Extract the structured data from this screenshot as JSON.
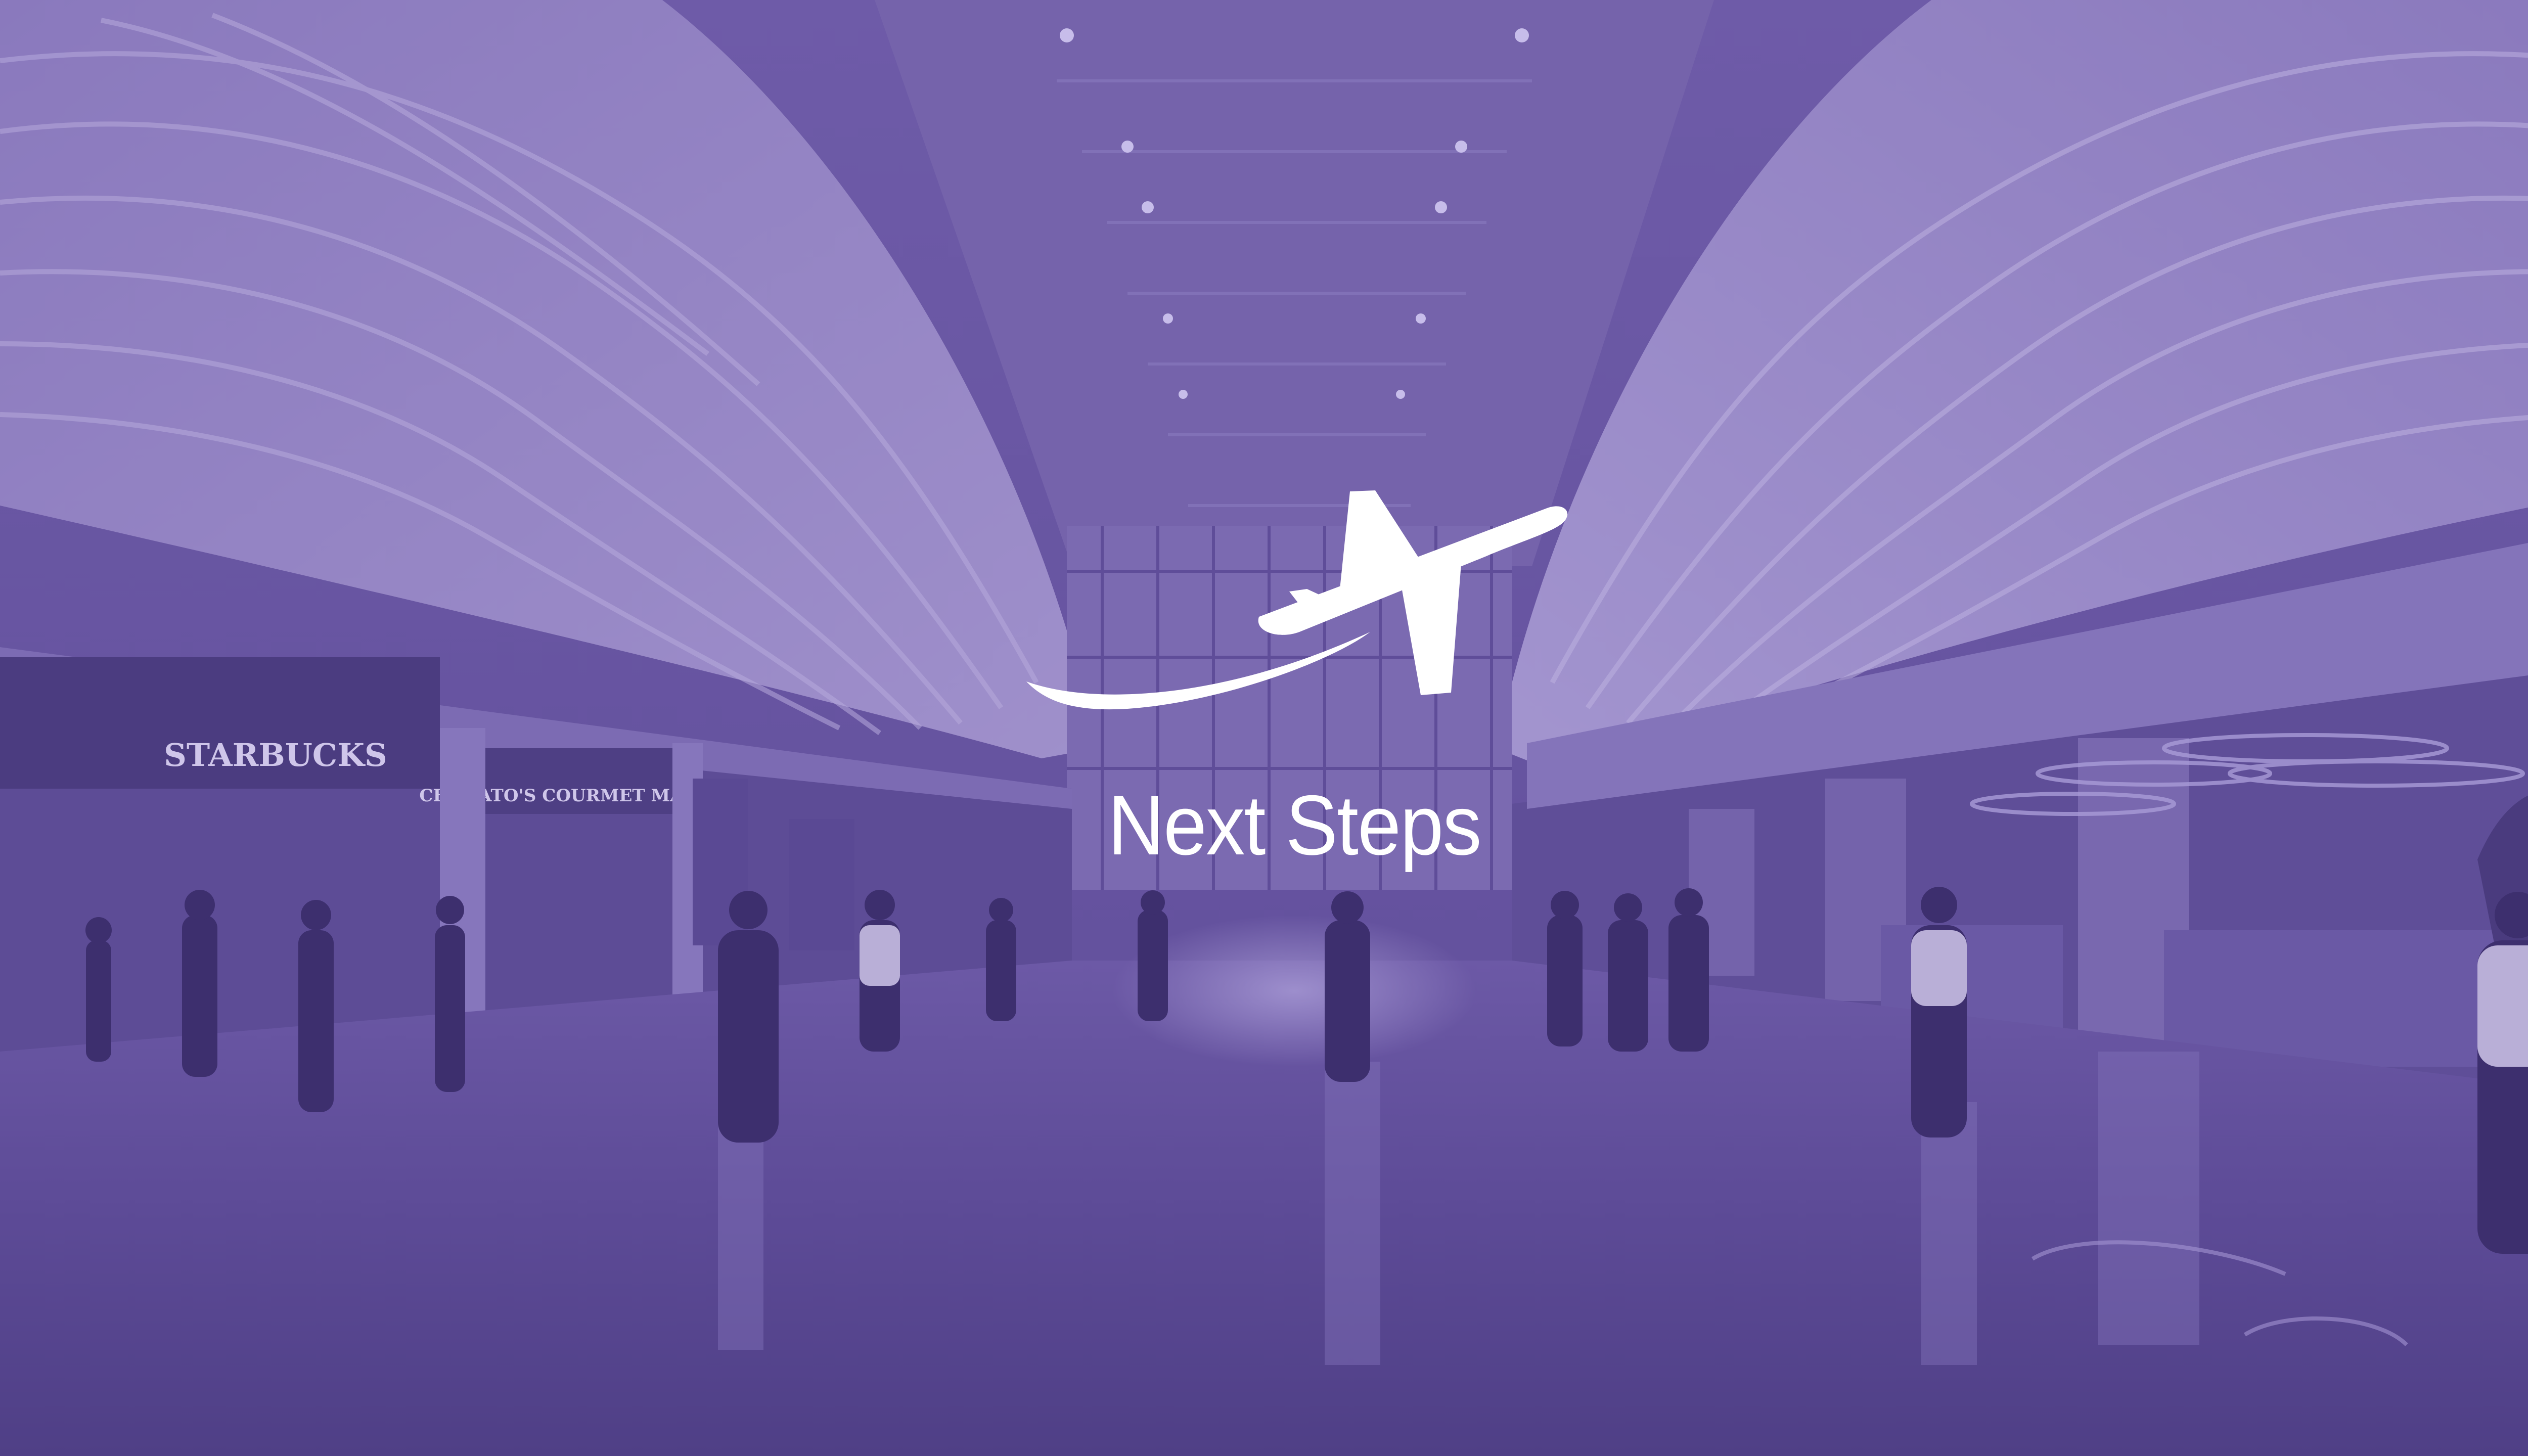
{
  "slide": {
    "title": "Next Steps",
    "background_color": "#6a57a3",
    "text_color": "#ffffff",
    "icon": "airplane-icon"
  },
  "scene": {
    "sign_starbucks": "STARBUCKS",
    "sign_market": "CHANATO'S COURMET MARKET"
  }
}
